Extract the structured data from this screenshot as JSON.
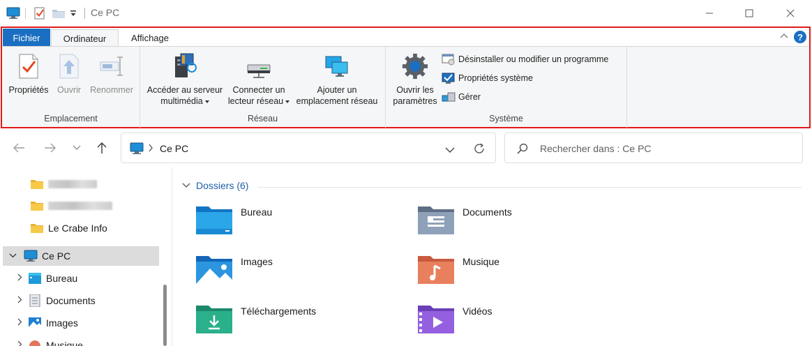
{
  "window": {
    "title": "Ce PC",
    "minimize_icon": "minimize-icon",
    "maximize_icon": "maximize-icon",
    "close_icon": "close-icon"
  },
  "ribbon": {
    "tabs": [
      {
        "label": "Fichier"
      },
      {
        "label": "Ordinateur"
      },
      {
        "label": "Affichage"
      }
    ],
    "groups": {
      "emplacement": {
        "label": "Emplacement",
        "proprietes": "Propriétés",
        "ouvrir": "Ouvrir",
        "renommer": "Renommer"
      },
      "reseau": {
        "label": "Réseau",
        "media_line1": "Accéder au serveur",
        "media_line2": "multimédia",
        "connect_line1": "Connecter un",
        "connect_line2": "lecteur réseau",
        "add_line1": "Ajouter un",
        "add_line2": "emplacement réseau"
      },
      "systeme": {
        "label": "Système",
        "settings_line1": "Ouvrir les",
        "settings_line2": "paramètres",
        "uninstall": "Désinstaller ou modifier un programme",
        "sysprops": "Propriétés système",
        "manage": "Gérer"
      }
    },
    "help": "?"
  },
  "address": {
    "path": "Ce PC",
    "search_placeholder": "Rechercher dans : Ce PC"
  },
  "nav": {
    "items": [
      {
        "label": ""
      },
      {
        "label": ""
      },
      {
        "label": "Le Crabe Info"
      },
      {
        "label": "Ce PC"
      },
      {
        "label": "Bureau"
      },
      {
        "label": "Documents"
      },
      {
        "label": "Images"
      },
      {
        "label": "Musique"
      }
    ]
  },
  "content": {
    "section_title": "Dossiers (6)",
    "folders": [
      {
        "label": "Bureau"
      },
      {
        "label": "Documents"
      },
      {
        "label": "Images"
      },
      {
        "label": "Musique"
      },
      {
        "label": "Téléchargements"
      },
      {
        "label": "Vidéos"
      }
    ]
  },
  "colors": {
    "accent": "#1a6fc2",
    "highlight_border": "#e01a1a",
    "selected_bg": "#dcdcdc"
  }
}
